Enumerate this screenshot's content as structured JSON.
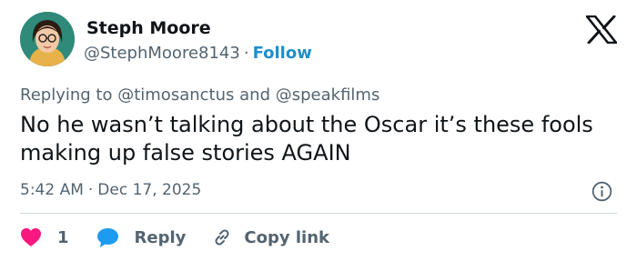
{
  "author": {
    "name": "Steph Moore",
    "handle": "@StephMoore8143",
    "separator": "·",
    "follow_label": "Follow"
  },
  "reply_context": {
    "prefix": "Replying to",
    "mention_1": "@timosanctus",
    "conjunction": "and",
    "mention_2": "@speakfilms"
  },
  "tweet": {
    "text": "No he wasn’t talking about the Oscar it’s these fools making up false stories AGAIN",
    "time": "5:42 AM",
    "separator": "·",
    "date": "Dec 17, 2025"
  },
  "actions": {
    "like_count": "1",
    "reply_label": "Reply",
    "copy_label": "Copy link"
  },
  "icons": {
    "brand": "x-logo-icon",
    "info": "info-icon",
    "like": "heart-icon",
    "reply": "speech-bubble-icon",
    "copy": "link-icon"
  },
  "colors": {
    "text": "#0f1419",
    "secondary": "#536471",
    "follow": "#1d8ecd",
    "like": "#f91880",
    "reply": "#1d9bf0",
    "divider": "#cfd9de"
  }
}
